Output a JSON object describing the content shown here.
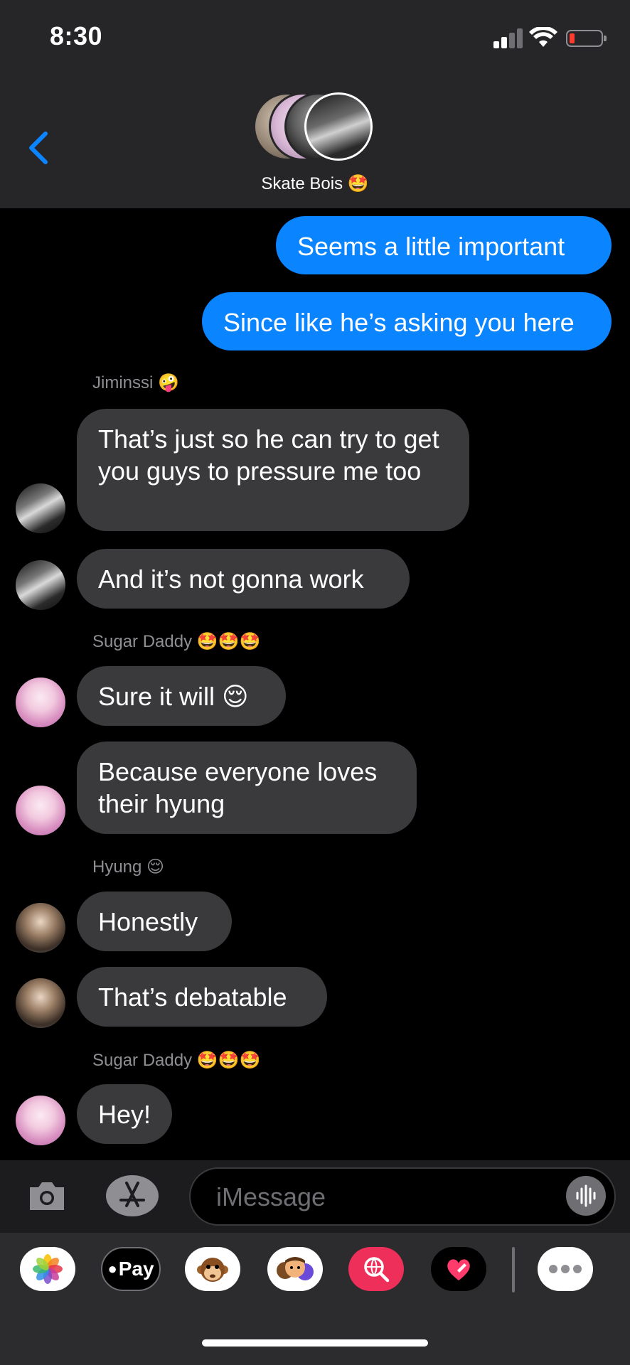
{
  "status_bar": {
    "time": "8:30"
  },
  "header": {
    "title": "Skate Bois 🤩"
  },
  "messages": {
    "out1": "Seems a little important",
    "out2": "Since like he’s asking you here",
    "sender_jiminssi": "Jiminssi 🤪",
    "jim1": "That’s just so he can try to get you guys to pressure me too",
    "jim2": "And it’s not gonna work",
    "sender_sugar": "Sugar Daddy 🤩🤩🤩",
    "sugar1": "Sure it will 😌",
    "sugar2": "Because everyone loves their hyung",
    "sender_hyung": "Hyung 😌",
    "hyung1": "Honestly",
    "hyung2": "That’s debatable",
    "sender_sugar2": "Sugar Daddy 🤩🤩🤩",
    "sugar3": "Hey!"
  },
  "composer": {
    "placeholder": "iMessage"
  },
  "drawer": {
    "apple_pay_label": "Pay"
  },
  "colors": {
    "outgoing": "#0a84ff",
    "incoming": "#3a3a3c",
    "header_bg": "#262628",
    "accent_back": "#0a84ff"
  }
}
